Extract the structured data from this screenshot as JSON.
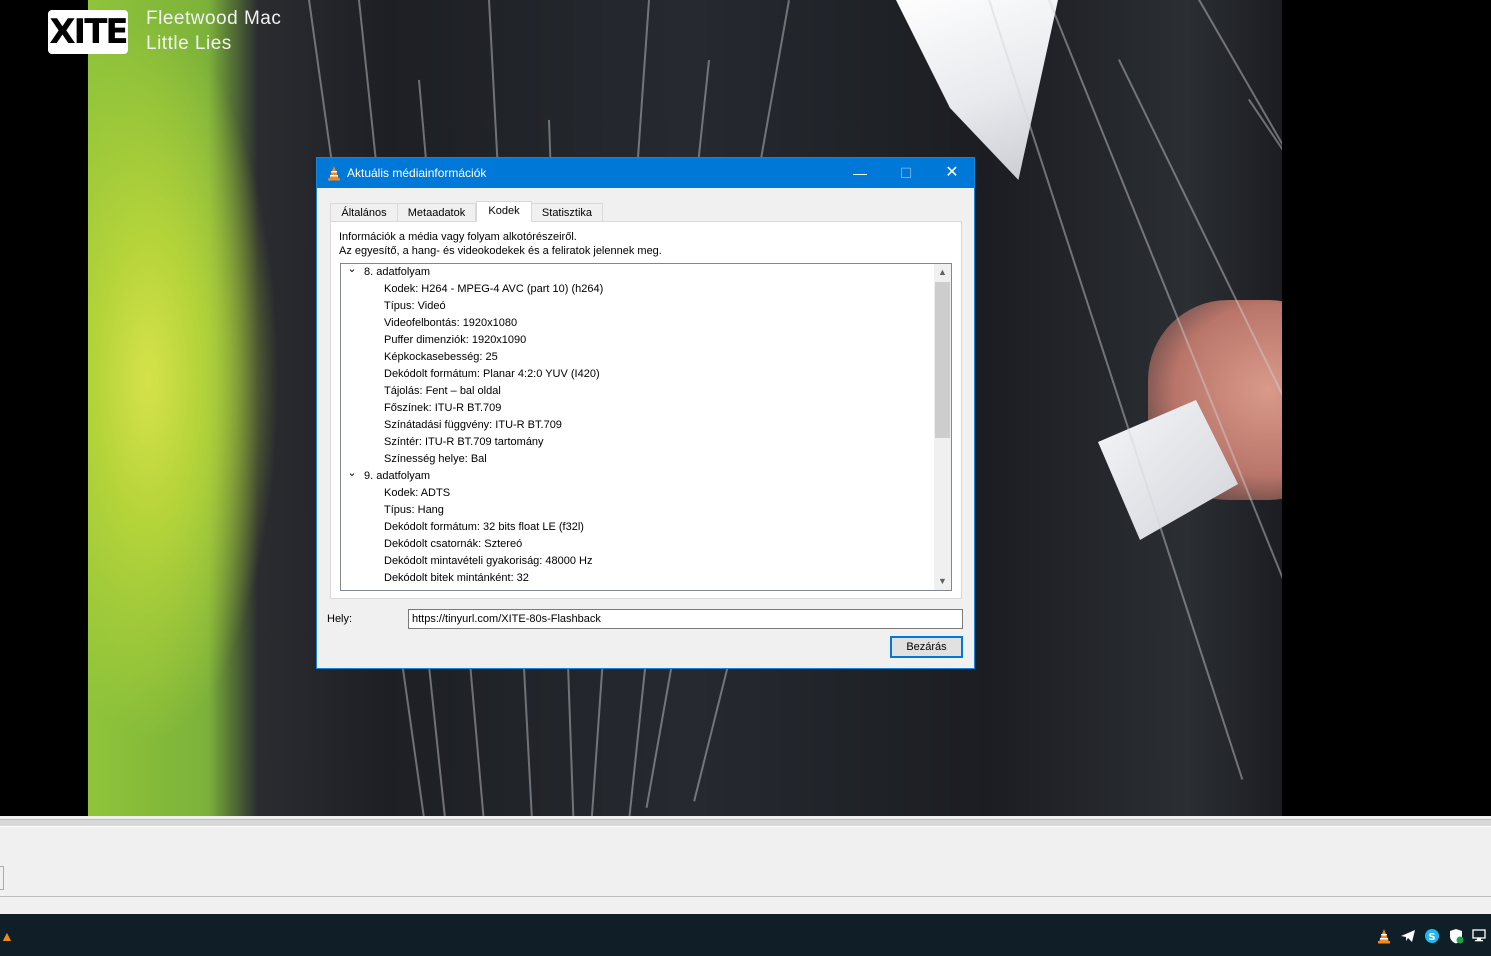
{
  "overlay": {
    "logo": "XITE",
    "artist": "Fleetwood Mac",
    "song": "Little Lies"
  },
  "dialog": {
    "title": "Aktuális médiainformációk",
    "tabs": [
      {
        "label": "Általános",
        "active": false
      },
      {
        "label": "Metaadatok",
        "active": false
      },
      {
        "label": "Kodek",
        "active": true
      },
      {
        "label": "Statisztika",
        "active": false
      }
    ],
    "description_line1": "Információk a média vagy folyam alkotórészeiről.",
    "description_line2": "Az egyesítő, a hang- és videokodekek és a feliratok jelennek meg.",
    "streams": [
      {
        "name": "8. adatfolyam",
        "items": [
          "Kodek: H264 - MPEG-4 AVC (part 10) (h264)",
          "Típus: Videó",
          "Videofelbontás: 1920x1080",
          "Puffer dimenziók: 1920x1090",
          "Képkockasebesség: 25",
          "Dekódolt formátum: Planar 4:2:0 YUV (I420)",
          "Tájolás: Fent – bal oldal",
          "Főszínek: ITU-R BT.709",
          "Színátadási függvény: ITU-R BT.709",
          "Színtér: ITU-R BT.709 tartomány",
          "Színesség helye: Bal"
        ]
      },
      {
        "name": "9. adatfolyam",
        "items": [
          "Kodek: ADTS",
          "Típus: Hang",
          "Dekódolt formátum: 32 bits float LE (f32l)",
          "Dekódolt csatornák: Sztereó",
          "Dekódolt mintavételi gyakoriság: 48000 Hz",
          "Dekódolt bitek mintánként: 32"
        ]
      }
    ],
    "location_label": "Hely:",
    "location_value": "https://tinyurl.com/XITE-80s-Flashback",
    "close_button": "Bezárás",
    "window_buttons": {
      "minimize": "—",
      "maximize": "☐",
      "close": "✕"
    }
  },
  "taskbar": {
    "tray_icons": [
      "vlc-icon",
      "telegram-icon",
      "skype-icon",
      "defender-icon",
      "network-icon"
    ]
  },
  "colors": {
    "accent": "#0078d7",
    "dialog_bg": "#f0f0f0",
    "taskbar": "#0f1e27",
    "vlc_orange": "#f08a1d"
  }
}
